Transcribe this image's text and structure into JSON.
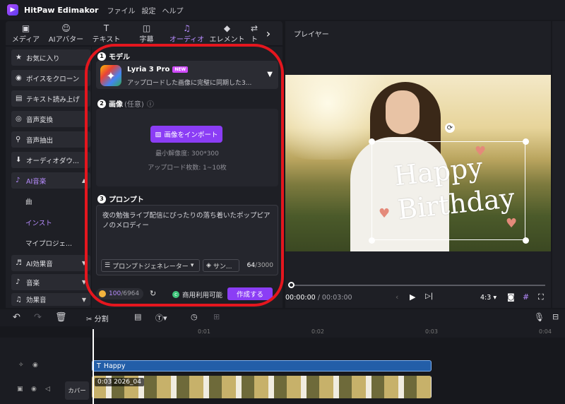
{
  "app": {
    "name": "HitPaw Edimakor",
    "menu": [
      "ファイル",
      "設定",
      "ヘルプ"
    ]
  },
  "top_tabs": [
    {
      "label": "メディア",
      "icon": "media-icon"
    },
    {
      "label": "AIアバター",
      "icon": "avatar-icon"
    },
    {
      "label": "テキスト",
      "icon": "text-icon"
    },
    {
      "label": "字幕",
      "icon": "subtitle-icon"
    },
    {
      "label": "オーディオ",
      "icon": "music-note-icon",
      "active": true
    },
    {
      "label": "エレメント",
      "icon": "element-icon"
    },
    {
      "label": "ト",
      "icon": "transition-icon"
    }
  ],
  "sidebar": {
    "items": [
      {
        "label": "お気に入り",
        "icon": "star-icon"
      },
      {
        "label": "ボイスをクローン",
        "icon": "clone-icon"
      },
      {
        "label": "テキスト読み上げ",
        "icon": "tts-icon"
      },
      {
        "label": "音声変換",
        "icon": "voice-change-icon"
      },
      {
        "label": "音声抽出",
        "icon": "mic-icon"
      },
      {
        "label": "オーディオダウ...",
        "icon": "download-icon"
      },
      {
        "label": "AI音楽",
        "icon": "ai-music-icon"
      }
    ],
    "sub_items": [
      "曲",
      "インスト",
      "マイプロジェ..."
    ],
    "bottom_items": [
      {
        "label": "AI効果音",
        "icon": "ai-sfx-icon"
      },
      {
        "label": "音楽",
        "icon": "music-icon"
      },
      {
        "label": "効果音",
        "icon": "sfx-icon"
      }
    ]
  },
  "ai_panel": {
    "model_section": {
      "num": "1",
      "title": "モデル"
    },
    "model": {
      "name": "Lyria 3 Pro",
      "badge": "NEW",
      "desc": "アップロードした画像に完璧に同期した3..."
    },
    "image_section": {
      "num": "2",
      "title": "画像",
      "optional": "(任意)",
      "info": "ⓘ"
    },
    "import_label": "画像をインポート",
    "min_res": "最小解像度: 300*300",
    "upload_count": "アップロード枚数: 1~10枚",
    "prompt_section": {
      "num": "3",
      "title": "プロンプト"
    },
    "prompt_text": "夜の勉強ライブ配信にぴったりの落ち着いたポップピアノのメロディー",
    "prompt_gen": "プロンプトジェネレーター",
    "sample": "サン...",
    "char_count": "64",
    "char_max": "/3000",
    "credits_used": "100",
    "credits_total": "/6964",
    "commercial": "商用利用可能",
    "create": "作成する"
  },
  "player": {
    "title": "プレイヤー",
    "overlay_text": [
      "Happy",
      "Birthday"
    ],
    "time_current": "00:00:00",
    "time_total": "/ 00:03:00",
    "ratio": "4:3"
  },
  "timeline": {
    "split_label": "分割",
    "ruler": [
      "0:01",
      "0:02",
      "0:03",
      "0:04"
    ],
    "text_clip": "Happy",
    "video_clip": "0:03  2026_04",
    "cover": "カバー"
  }
}
